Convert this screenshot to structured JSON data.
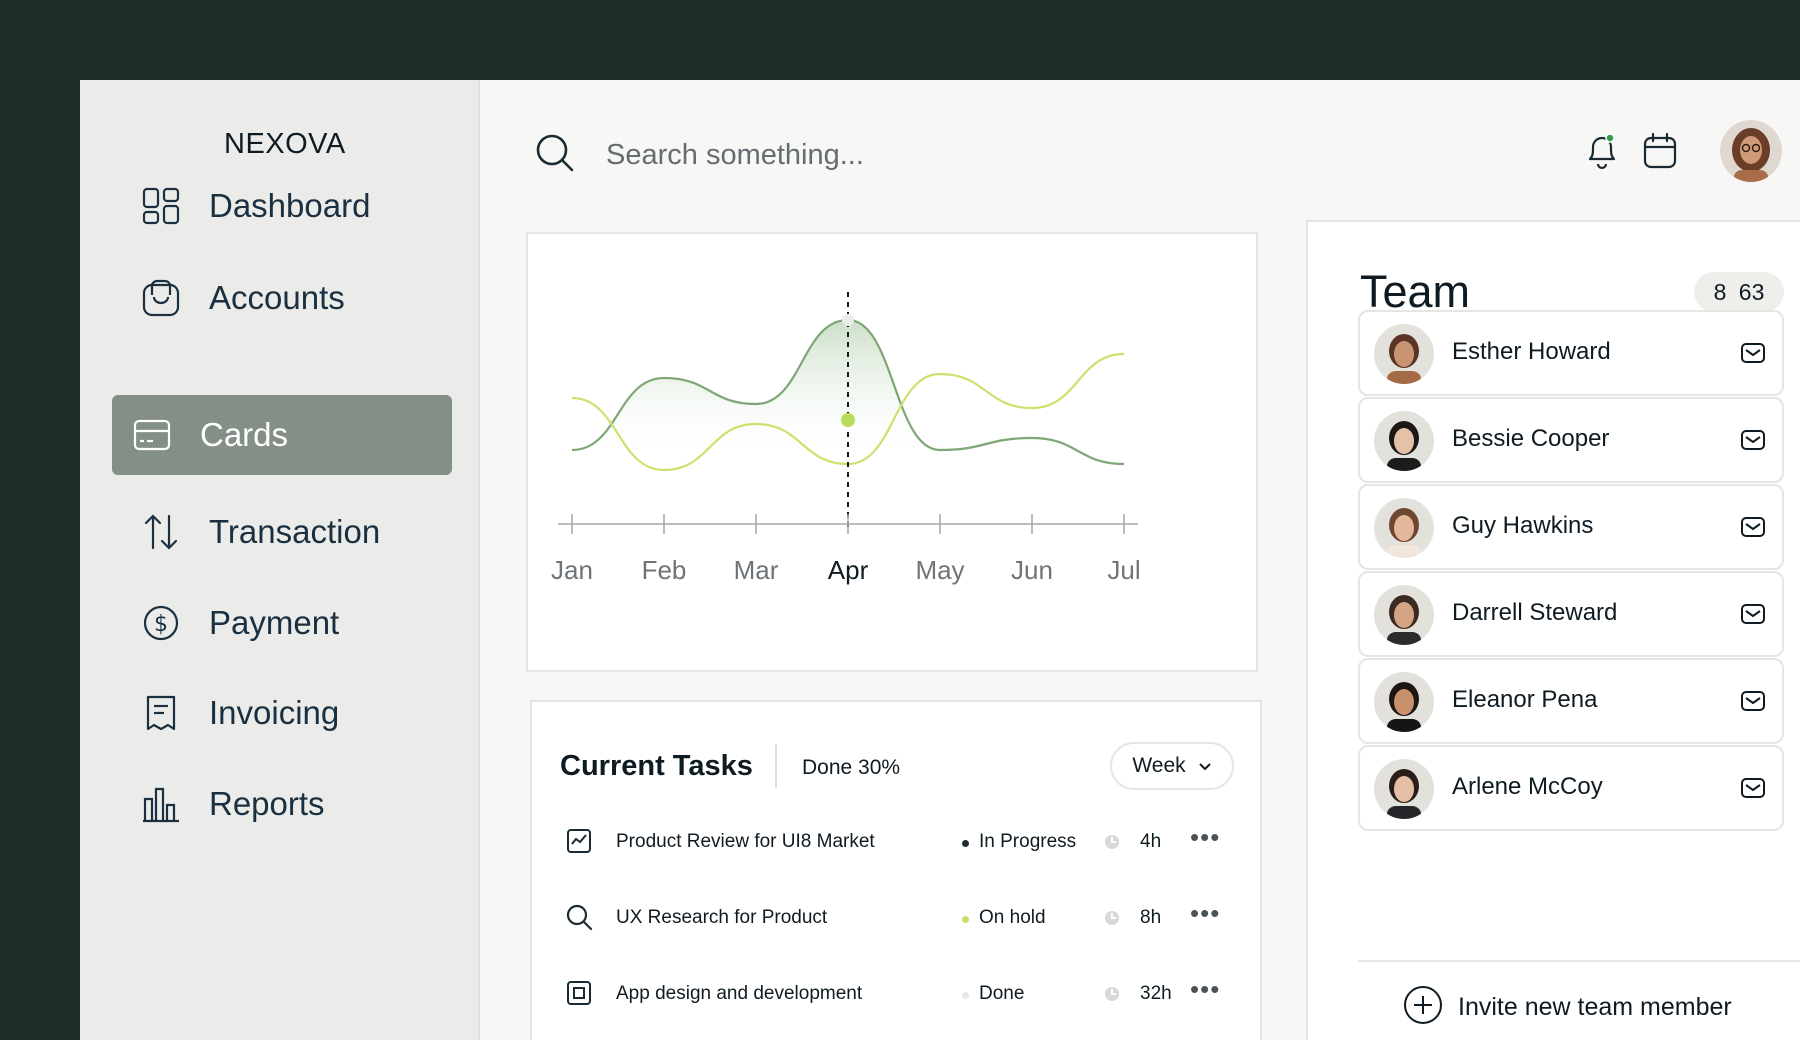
{
  "brand": {
    "name": "NEXOVA"
  },
  "sidebar": {
    "items": [
      {
        "label": "Dashboard",
        "icon": "grid-icon",
        "active": false
      },
      {
        "label": "Accounts",
        "icon": "wallet-icon",
        "active": false
      },
      {
        "label": "Cards",
        "icon": "card-icon",
        "active": true
      },
      {
        "label": "Transaction",
        "icon": "arrows-updown-icon",
        "active": false
      },
      {
        "label": "Payment",
        "icon": "dollar-circle-icon",
        "active": false
      },
      {
        "label": "Invoicing",
        "icon": "receipt-icon",
        "active": false
      },
      {
        "label": "Reports",
        "icon": "bar-chart-icon",
        "active": false
      }
    ]
  },
  "header": {
    "search_placeholder": "Search something...",
    "icons": [
      "search-icon",
      "bell-icon",
      "calendar-icon",
      "avatar"
    ]
  },
  "chart_data": {
    "type": "line",
    "categories": [
      "Jan",
      "Feb",
      "Mar",
      "Apr",
      "May",
      "Jun",
      "Jul"
    ],
    "highlighted_category": "Apr",
    "series": [
      {
        "values": [
          17,
          53,
          40,
          82,
          17,
          23,
          10
        ],
        "color": "#7fa676",
        "fill": "area"
      },
      {
        "values": [
          43,
          7,
          30,
          10,
          55,
          38,
          65
        ],
        "color": "#c9e36e",
        "fill": "none"
      }
    ],
    "marker": {
      "category": "Apr",
      "value": 32,
      "color": "#b8dd5c"
    },
    "ylim": [
      0,
      100
    ],
    "grid": false,
    "legend": "none"
  },
  "tasks": {
    "title": "Current Tasks",
    "done_label": "Done 30%",
    "period": "Week",
    "rows": [
      {
        "icon": "chart-square-icon",
        "name": "Product Review for UI8 Market",
        "status": "In Progress",
        "status_color": "#1d2a30",
        "time": "4h"
      },
      {
        "icon": "search-icon",
        "name": "UX Research for Product",
        "status": "On hold",
        "status_color": "#c6e070",
        "time": "8h"
      },
      {
        "icon": "frame-square-icon",
        "name": "App design and development",
        "status": "Done",
        "status_color": "#e6e8e4",
        "time": "32h"
      }
    ],
    "more_label": "•••"
  },
  "team": {
    "title": "Team",
    "badge_icon": "8",
    "badge_count": "63",
    "members": [
      {
        "name": "Esther Howard",
        "skin": "#c99473",
        "hair": "#5a3424",
        "shirt": "#a36a45"
      },
      {
        "name": "Bessie Cooper",
        "skin": "#e3c2a8",
        "hair": "#1c1816",
        "shirt": "#1c1c1c"
      },
      {
        "name": "Guy Hawkins",
        "skin": "#e4b89b",
        "hair": "#6e4632",
        "shirt": "#f1e6dc"
      },
      {
        "name": "Darrell Steward",
        "skin": "#d3a584",
        "hair": "#3b2a20",
        "shirt": "#2b2b2b"
      },
      {
        "name": "Eleanor Pena",
        "skin": "#c9906c",
        "hair": "#1d1512",
        "shirt": "#151515"
      },
      {
        "name": "Arlene McCoy",
        "skin": "#e6c0a6",
        "hair": "#2a1e1a",
        "shirt": "#26262a"
      }
    ],
    "invite_label": "Invite new team member"
  },
  "colors": {
    "background": "#1d2f28",
    "sidebar": "#ebecea",
    "active_nav": "#849087",
    "accent_green": "#7fa676",
    "accent_lime": "#c9e36e",
    "notification_dot": "#2ea043"
  }
}
